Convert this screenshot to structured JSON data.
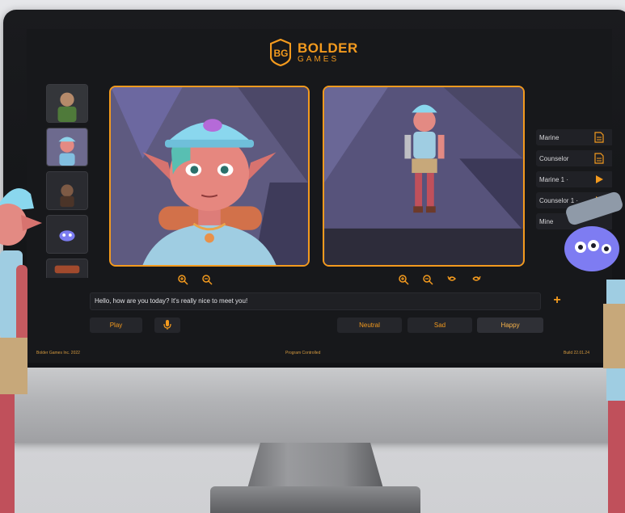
{
  "brand": {
    "name": "BOLDER",
    "sub": "GAMES",
    "accent_color": "#f39a1e"
  },
  "thumbnails": [
    {
      "name": "character-thumbnail-orc"
    },
    {
      "name": "character-thumbnail-elf-girl"
    },
    {
      "name": "character-thumbnail-dwarf"
    },
    {
      "name": "character-thumbnail-alien"
    },
    {
      "name": "character-thumbnail-partial"
    }
  ],
  "viewports": {
    "left": {
      "zoom_in_icon": "zoom-in-icon",
      "zoom_out_icon": "zoom-out-icon"
    },
    "right": {
      "zoom_in_icon": "zoom-in-icon",
      "zoom_out_icon": "zoom-out-icon",
      "rotate_left_icon": "rotate-left-icon",
      "rotate_right_icon": "rotate-right-icon"
    }
  },
  "side_list": [
    {
      "label": "Marine",
      "icon": "document-icon"
    },
    {
      "label": "Counselor",
      "icon": "document-icon"
    },
    {
      "label": "Marine 1 ·",
      "icon": "play-icon"
    },
    {
      "label": "Counselor 1 ·",
      "icon": "play-icon"
    },
    {
      "label": "Mine",
      "icon": ""
    }
  ],
  "input": {
    "value": "Hello, how are you today? It's really nice to meet you!"
  },
  "actions": {
    "play": "Play",
    "mic_icon": "microphone-icon",
    "emotions": [
      "Neutral",
      "Sad",
      "Happy"
    ],
    "selected_emotion": "Happy",
    "plus": "+"
  },
  "footer": {
    "left": "Bolder Games Inc. 2022",
    "center": "Program Controlled",
    "right": "Build 22.01.24"
  }
}
